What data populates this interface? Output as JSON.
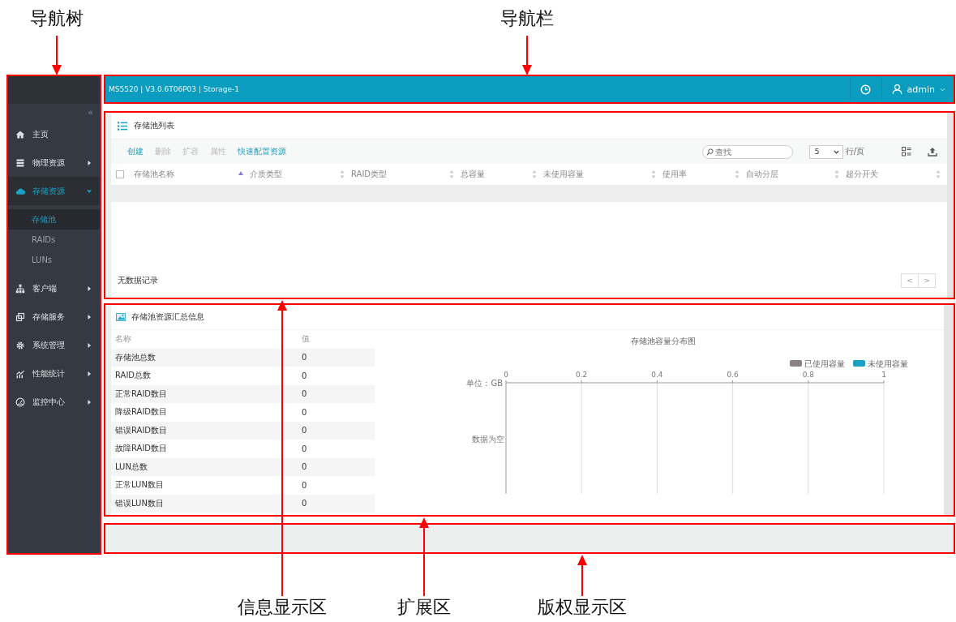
{
  "annotations": {
    "top": [
      {
        "text": "导航树"
      },
      {
        "text": "导航栏"
      }
    ],
    "bottom": [
      {
        "text": "信息显示区"
      },
      {
        "text": "扩展区"
      },
      {
        "text": "版权显示区"
      }
    ]
  },
  "sidebar": {
    "collapse_glyph": "«",
    "items": [
      {
        "label": "主页",
        "kind": "link",
        "selected": false
      },
      {
        "label": "物理资源",
        "kind": "group",
        "selected": false,
        "expanded": false
      },
      {
        "label": "存储资源",
        "kind": "group",
        "selected": true,
        "expanded": true,
        "children": [
          {
            "label": "存储池",
            "selected": true
          },
          {
            "label": "RAIDs",
            "selected": false
          },
          {
            "label": "LUNs",
            "selected": false
          }
        ]
      },
      {
        "label": "客户端",
        "kind": "group",
        "selected": false,
        "expanded": false
      },
      {
        "label": "存储服务",
        "kind": "group",
        "selected": false,
        "expanded": false
      },
      {
        "label": "系统管理",
        "kind": "group",
        "selected": false,
        "expanded": false
      },
      {
        "label": "性能统计",
        "kind": "group",
        "selected": false,
        "expanded": false
      },
      {
        "label": "监控中心",
        "kind": "group",
        "selected": false,
        "expanded": false
      }
    ]
  },
  "top_bar": {
    "title": "MS5520 | V3.0.6T06P03 | Storage-1",
    "user": "admin"
  },
  "pool_list": {
    "title": "存储池列表",
    "actions": [
      {
        "label": "创建",
        "disabled": false
      },
      {
        "label": "删除",
        "disabled": true
      },
      {
        "label": "扩容",
        "disabled": true
      },
      {
        "label": "属性",
        "disabled": true
      },
      {
        "label": "快速配置资源",
        "disabled": false
      }
    ],
    "search": {
      "placeholder": "查找"
    },
    "page_size": "5",
    "page_size_unit": "行/页",
    "header_checkbox": {
      "checked": false
    },
    "columns": [
      {
        "label": "存储池名称",
        "sorted": true
      },
      {
        "label": "介质类型",
        "sorted": false
      },
      {
        "label": "RAID类型",
        "sorted": false
      },
      {
        "label": "总容量",
        "sorted": false
      },
      {
        "label": "未使用容量",
        "sorted": false
      },
      {
        "label": "使用率",
        "sorted": false
      },
      {
        "label": "自动分层",
        "sorted": false
      },
      {
        "label": "超分开关",
        "sorted": false
      }
    ],
    "empty_text": "无数据记录",
    "pager": [
      "<",
      ">"
    ]
  },
  "summary": {
    "title": "存储池资源汇总信息",
    "columns": [
      "名称",
      "值"
    ],
    "rows": [
      {
        "name": "存储池总数",
        "value": "0"
      },
      {
        "name": "RAID总数",
        "value": "0"
      },
      {
        "name": "正常RAID数目",
        "value": "0"
      },
      {
        "name": "降级RAID数目",
        "value": "0"
      },
      {
        "name": "错误RAID数目",
        "value": "0"
      },
      {
        "name": "故障RAID数目",
        "value": "0"
      },
      {
        "name": "LUN总数",
        "value": "0"
      },
      {
        "name": "正常LUN数目",
        "value": "0"
      },
      {
        "name": "错误LUN数目",
        "value": "0"
      }
    ],
    "chart_data": {
      "type": "bar",
      "orientation": "horizontal",
      "grid": true,
      "title": "存储池容量分布图",
      "xlabel": "单位：GB",
      "categories": [
        "数据为空"
      ],
      "xlim": [
        0,
        1
      ],
      "xticks": [
        0,
        0.2,
        0.4,
        0.6,
        0.8,
        1
      ],
      "series": [
        {
          "name": "已使用容量",
          "color": "#898383",
          "values": [
            null
          ]
        },
        {
          "name": "未使用容量",
          "color": "#1ba1c5",
          "values": [
            null
          ]
        }
      ]
    }
  }
}
